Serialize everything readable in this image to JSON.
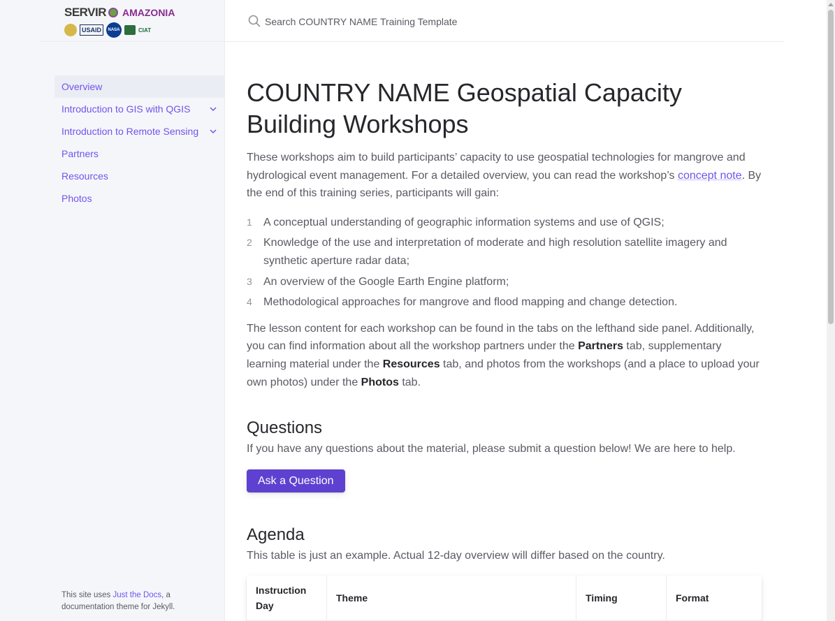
{
  "logo": {
    "servir": "SERVIR",
    "amazonia": "AMAZONIA",
    "partners": [
      "SIG",
      "USAID",
      "NASA",
      "CIAT"
    ]
  },
  "search": {
    "placeholder": "Search COUNTRY NAME Training Template"
  },
  "sidebar": {
    "items": [
      {
        "label": "Overview",
        "active": true,
        "expandable": false
      },
      {
        "label": "Introduction to GIS with QGIS",
        "active": false,
        "expandable": true
      },
      {
        "label": "Introduction to Remote Sensing",
        "active": false,
        "expandable": true
      },
      {
        "label": "Partners",
        "active": false,
        "expandable": false
      },
      {
        "label": "Resources",
        "active": false,
        "expandable": false
      },
      {
        "label": "Photos",
        "active": false,
        "expandable": false
      }
    ],
    "footer": {
      "prefix": "This site uses ",
      "link": "Just the Docs",
      "suffix": ", a documentation theme for Jekyll."
    }
  },
  "main": {
    "title": "COUNTRY NAME Geospatial Capacity Building Workshops",
    "intro_part1": "These workshops aim to build participants’ capacity to use geospatial technologies for mangrove and hydrological event management. For a detailed overview, you can read the workshop’s ",
    "intro_link": "concept note",
    "intro_part2": ". By the end of this training series, participants will gain:",
    "goals": [
      {
        "num": "1",
        "text": "A conceptual understanding of geographic information systems and use of QGIS;"
      },
      {
        "num": "2",
        "text": "Knowledge of the use and interpretation of moderate and high resolution satellite imagery and synthetic aperture radar data;"
      },
      {
        "num": "3",
        "text": "An overview of the Google Earth Engine platform;"
      },
      {
        "num": "4",
        "text": "Methodological approaches for mangrove and flood mapping and change detection."
      }
    ],
    "lesson": {
      "t1": "The lesson content for each workshop can be found in the tabs on the lefthand side panel. Additionally, you can find information about all the workshop partners under the ",
      "b1": "Partners",
      "t2": " tab, supplementary learning material under the ",
      "b2": "Resources",
      "t3": " tab, and photos from the workshops (and a place to upload your own photos) under the ",
      "b3": "Photos",
      "t4": " tab."
    },
    "questions": {
      "heading": "Questions",
      "text": "If you have any questions about the material, please submit a question below! We are here to help.",
      "button": "Ask a Question"
    },
    "agenda": {
      "heading": "Agenda",
      "text": "This table is just an example. Actual 12-day overview will differ based on the country.",
      "columns": [
        "Instruction Day",
        "Theme",
        "Timing",
        "Format"
      ]
    }
  },
  "colors": {
    "accent": "#7253ed",
    "button": "#5e41d0",
    "sidebar_bg": "#f5f6fa",
    "heading": "#27262b",
    "body_text": "#5c5962"
  }
}
